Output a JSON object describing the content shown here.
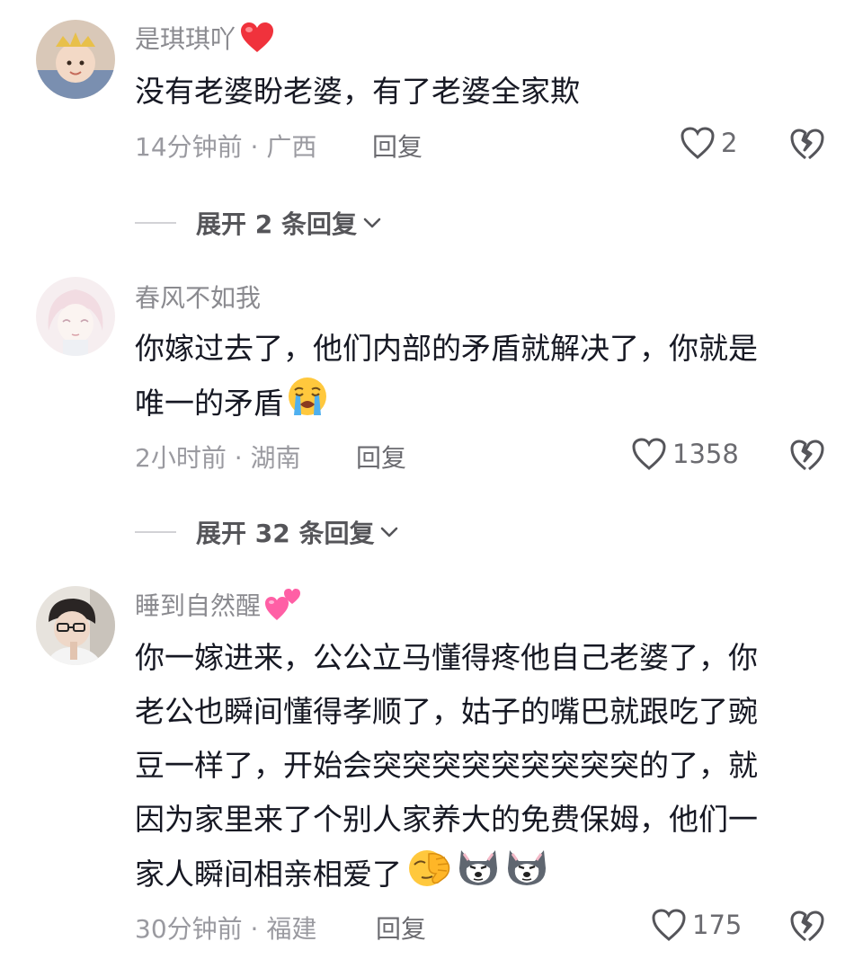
{
  "comments": [
    {
      "username": "是琪琪吖",
      "username_emoji": "red-heart-icon",
      "lines": [
        "没有老婆盼老婆，有了老婆全家欺"
      ],
      "time_location": "14分钟前 · 广西",
      "reply_label": "回复",
      "like_count": "2",
      "expand_label": "展开 2 条回复"
    },
    {
      "username": "春风不如我",
      "lines": [
        "你嫁过去了，他们内部的矛盾就解决了，你就是",
        "唯一的矛盾"
      ],
      "line_end_emojis": [
        "loudly-crying-face-icon"
      ],
      "time_location": "2小时前 · 湖南",
      "reply_label": "回复",
      "like_count": "1358",
      "expand_label": "展开 32 条回复"
    },
    {
      "username": "睡到自然醒",
      "username_emoji": "two-hearts-icon",
      "lines": [
        "你一嫁进来，公公立马懂得疼他自己老婆了，你",
        "老公也瞬间懂得孝顺了，姑子的嘴巴就跟吃了豌",
        "豆一样了，开始会突突突突突突突突突的了，就",
        "因为家里来了个别人家养大的免费保姆，他们一",
        "家人瞬间相亲相爱了"
      ],
      "line_end_emojis": [
        "face-palm-icon",
        "husky-dog-icon",
        "husky-dog-icon"
      ],
      "time_location": "30分钟前 · 福建",
      "reply_label": "回复",
      "like_count": "175"
    }
  ]
}
